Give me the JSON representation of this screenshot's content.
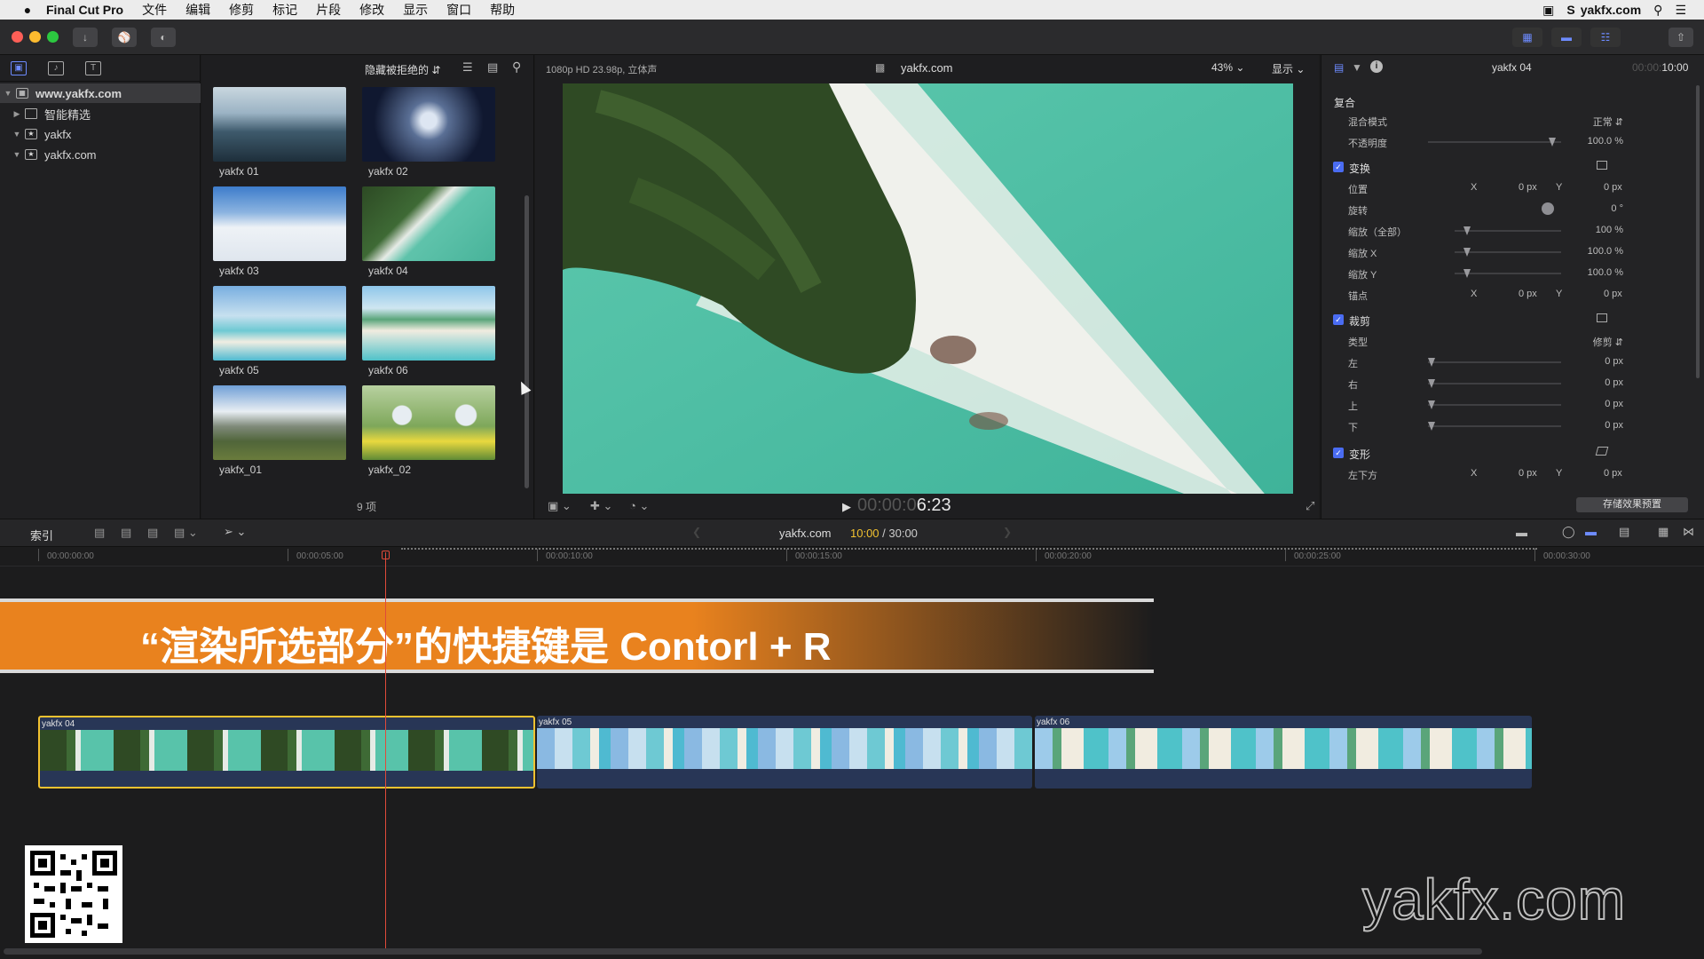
{
  "menubar": {
    "apple": "",
    "app_name": "Final Cut Pro",
    "items": [
      "文件",
      "编辑",
      "修剪",
      "标记",
      "片段",
      "修改",
      "显示",
      "窗口",
      "帮助"
    ],
    "right_site": "yakfx.com"
  },
  "library": {
    "items": [
      {
        "label": "www.yakfx.com",
        "expanded": true
      },
      {
        "label": "智能精选",
        "expanded": false
      },
      {
        "label": "yakfx",
        "expanded": true
      },
      {
        "label": "yakfx.com",
        "expanded": true
      }
    ]
  },
  "browser": {
    "filter_label": "隐藏被拒绝的",
    "clips": [
      "yakfx 01",
      "yakfx 02",
      "yakfx 03",
      "yakfx 04",
      "yakfx 05",
      "yakfx 06",
      "yakfx_01",
      "yakfx_02"
    ],
    "count_label": "9 项"
  },
  "viewer": {
    "format": "1080p HD 23.98p, 立体声",
    "project_name": "yakfx.com",
    "zoom": "43%",
    "display_label": "显示",
    "timecode_dim": "00:00:0",
    "timecode_bright": "6:23"
  },
  "inspector": {
    "clip_name": "yakfx 04",
    "duration_dim": "00:00:",
    "duration_bright": "10:00",
    "composite_label": "复合",
    "blend_mode_label": "混合模式",
    "blend_mode_value": "正常",
    "opacity_label": "不透明度",
    "opacity_value": "100.0 %",
    "transform_label": "变换",
    "position_label": "位置",
    "position_x": "0 px",
    "position_y": "0 px",
    "rotation_label": "旋转",
    "rotation_value": "0 °",
    "scale_all_label": "缩放（全部）",
    "scale_all_value": "100 %",
    "scale_x_label": "缩放 X",
    "scale_x_value": "100.0 %",
    "scale_y_label": "缩放 Y",
    "scale_y_value": "100.0 %",
    "anchor_label": "锚点",
    "anchor_x": "0 px",
    "anchor_y": "0 px",
    "crop_label": "裁剪",
    "crop_type_label": "类型",
    "crop_type_value": "修剪",
    "crop_left_label": "左",
    "crop_left_value": "0 px",
    "crop_right_label": "右",
    "crop_right_value": "0 px",
    "crop_top_label": "上",
    "crop_top_value": "0 px",
    "crop_bottom_label": "下",
    "crop_bottom_value": "0 px",
    "distort_label": "变形",
    "bottom_left_label": "左下方",
    "bottom_left_x": "0 px",
    "bottom_left_y": "0 px",
    "x_label": "X",
    "y_label": "Y",
    "save_preset_label": "存储效果预置"
  },
  "timeline_bar": {
    "index_label": "索引",
    "project_name": "yakfx.com",
    "position": "10:00",
    "total": " / 30:00"
  },
  "ruler": [
    "00:00:00:00",
    "00:00:05:00",
    "00:00:10:00",
    "00:00:15:00",
    "00:00:20:00",
    "00:00:25:00",
    "00:00:30:00"
  ],
  "banner": {
    "text": "“渲染所选部分”的快捷键是 Contorl + R"
  },
  "clips": [
    {
      "name": "yakfx 04",
      "selected": true
    },
    {
      "name": "yakfx 05",
      "selected": false
    },
    {
      "name": "yakfx 06",
      "selected": false
    }
  ],
  "watermark": "yakfx.com",
  "colors": {
    "accent": "#4a6cf2",
    "banner": "#e9821e",
    "playhead": "#e04a3a",
    "selection": "#f2c230"
  }
}
